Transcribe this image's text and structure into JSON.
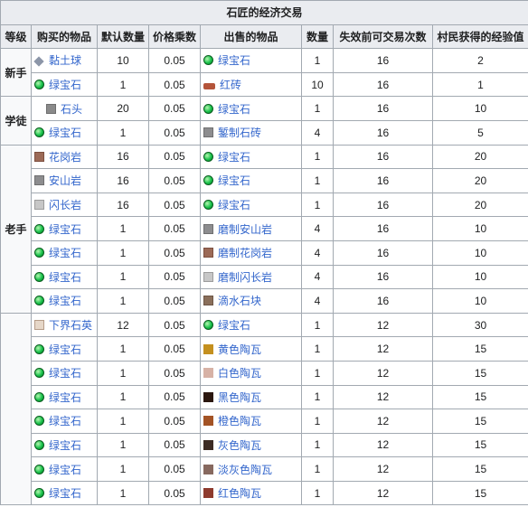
{
  "caption": "石匠的经济交易",
  "headers": {
    "level": "等级",
    "buy_item": "购买的物品",
    "default_qty": "默认数量",
    "price_multiplier": "价格乘数",
    "sell_item": "出售的物品",
    "qty": "数量",
    "max_uses": "失效前可交易次数",
    "villager_xp": "村民获得的经验值"
  },
  "levels": {
    "novice": "新手",
    "apprentice": "学徒",
    "journeyman": "老手"
  },
  "rows": [
    {
      "buy": "黏土球",
      "buy_icon": "clay-ball-icon",
      "default_qty": "10",
      "multiplier": "0.05",
      "sell": "绿宝石",
      "sell_icon": "emerald-icon",
      "qty": "1",
      "uses": "16",
      "xp": "2"
    },
    {
      "buy": "绿宝石",
      "buy_icon": "emerald-icon",
      "default_qty": "1",
      "multiplier": "0.05",
      "sell": "红砖",
      "sell_icon": "brick-icon",
      "qty": "10",
      "uses": "16",
      "xp": "1"
    },
    {
      "buy": "石头",
      "buy_icon": "stone-icon",
      "default_qty": "20",
      "multiplier": "0.05",
      "sell": "绿宝石",
      "sell_icon": "emerald-icon",
      "qty": "1",
      "uses": "16",
      "xp": "10"
    },
    {
      "buy": "绿宝石",
      "buy_icon": "emerald-icon",
      "default_qty": "1",
      "multiplier": "0.05",
      "sell": "錾制石砖",
      "sell_icon": "chiseled-stone-bricks-icon",
      "qty": "4",
      "uses": "16",
      "xp": "5"
    },
    {
      "buy": "花岗岩",
      "buy_icon": "granite-icon",
      "default_qty": "16",
      "multiplier": "0.05",
      "sell": "绿宝石",
      "sell_icon": "emerald-icon",
      "qty": "1",
      "uses": "16",
      "xp": "20"
    },
    {
      "buy": "安山岩",
      "buy_icon": "andesite-icon",
      "default_qty": "16",
      "multiplier": "0.05",
      "sell": "绿宝石",
      "sell_icon": "emerald-icon",
      "qty": "1",
      "uses": "16",
      "xp": "20"
    },
    {
      "buy": "闪长岩",
      "buy_icon": "diorite-icon",
      "default_qty": "16",
      "multiplier": "0.05",
      "sell": "绿宝石",
      "sell_icon": "emerald-icon",
      "qty": "1",
      "uses": "16",
      "xp": "20"
    },
    {
      "buy": "绿宝石",
      "buy_icon": "emerald-icon",
      "default_qty": "1",
      "multiplier": "0.05",
      "sell": "磨制安山岩",
      "sell_icon": "polished-andesite-icon",
      "qty": "4",
      "uses": "16",
      "xp": "10"
    },
    {
      "buy": "绿宝石",
      "buy_icon": "emerald-icon",
      "default_qty": "1",
      "multiplier": "0.05",
      "sell": "磨制花岗岩",
      "sell_icon": "polished-granite-icon",
      "qty": "4",
      "uses": "16",
      "xp": "10"
    },
    {
      "buy": "绿宝石",
      "buy_icon": "emerald-icon",
      "default_qty": "1",
      "multiplier": "0.05",
      "sell": "磨制闪长岩",
      "sell_icon": "polished-diorite-icon",
      "qty": "4",
      "uses": "16",
      "xp": "10"
    },
    {
      "buy": "绿宝石",
      "buy_icon": "emerald-icon",
      "default_qty": "1",
      "multiplier": "0.05",
      "sell": "滴水石块",
      "sell_icon": "dripstone-block-icon",
      "qty": "4",
      "uses": "16",
      "xp": "10"
    },
    {
      "buy": "下界石英",
      "buy_icon": "nether-quartz-icon",
      "default_qty": "12",
      "multiplier": "0.05",
      "sell": "绿宝石",
      "sell_icon": "emerald-icon",
      "qty": "1",
      "uses": "12",
      "xp": "30"
    },
    {
      "buy": "绿宝石",
      "buy_icon": "emerald-icon",
      "default_qty": "1",
      "multiplier": "0.05",
      "sell": "黄色陶瓦",
      "sell_icon": "yellow-terracotta-icon",
      "qty": "1",
      "uses": "12",
      "xp": "15"
    },
    {
      "buy": "绿宝石",
      "buy_icon": "emerald-icon",
      "default_qty": "1",
      "multiplier": "0.05",
      "sell": "白色陶瓦",
      "sell_icon": "white-terracotta-icon",
      "qty": "1",
      "uses": "12",
      "xp": "15"
    },
    {
      "buy": "绿宝石",
      "buy_icon": "emerald-icon",
      "default_qty": "1",
      "multiplier": "0.05",
      "sell": "黑色陶瓦",
      "sell_icon": "black-terracotta-icon",
      "qty": "1",
      "uses": "12",
      "xp": "15"
    },
    {
      "buy": "绿宝石",
      "buy_icon": "emerald-icon",
      "default_qty": "1",
      "multiplier": "0.05",
      "sell": "橙色陶瓦",
      "sell_icon": "orange-terracotta-icon",
      "qty": "1",
      "uses": "12",
      "xp": "15"
    },
    {
      "buy": "绿宝石",
      "buy_icon": "emerald-icon",
      "default_qty": "1",
      "multiplier": "0.05",
      "sell": "灰色陶瓦",
      "sell_icon": "gray-terracotta-icon",
      "qty": "1",
      "uses": "12",
      "xp": "15"
    },
    {
      "buy": "绿宝石",
      "buy_icon": "emerald-icon",
      "default_qty": "1",
      "multiplier": "0.05",
      "sell": "淡灰色陶瓦",
      "sell_icon": "light-gray-terracotta-icon",
      "qty": "1",
      "uses": "12",
      "xp": "15"
    },
    {
      "buy": "绿宝石",
      "buy_icon": "emerald-icon",
      "default_qty": "1",
      "multiplier": "0.05",
      "sell": "红色陶瓦",
      "sell_icon": "red-terracotta-icon",
      "qty": "1",
      "uses": "12",
      "xp": "15"
    }
  ]
}
